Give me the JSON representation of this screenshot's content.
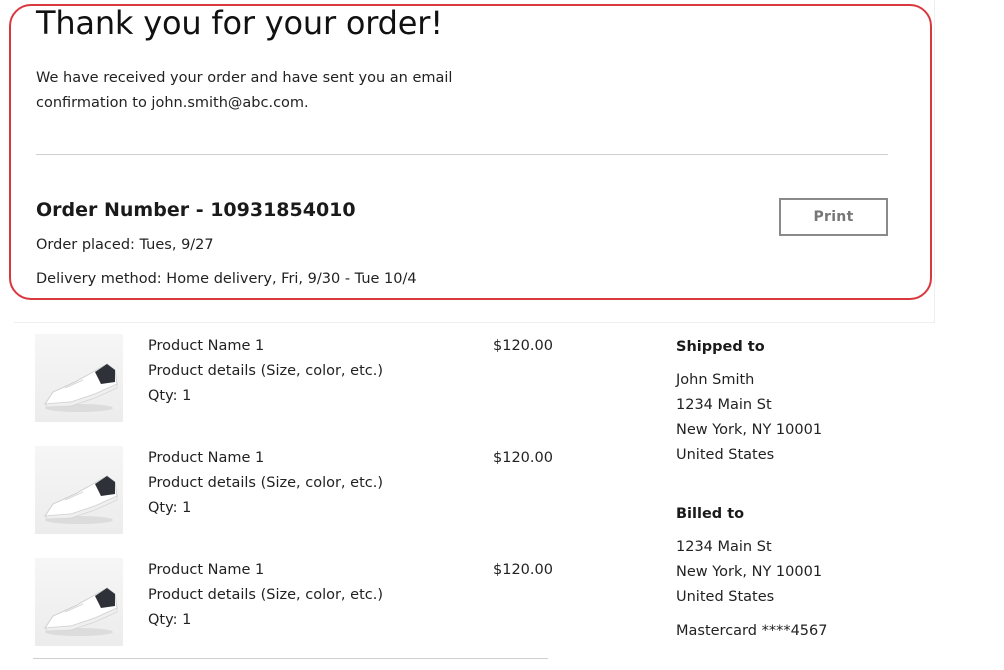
{
  "confirmation": {
    "title": "Thank you for your order!",
    "message": "We have received your order and have sent you an email confirmation to john.smith@abc.com."
  },
  "order": {
    "number_label": "Order Number - 10931854010",
    "placed": "Order placed: Tues, 9/27",
    "delivery": "Delivery method: Home delivery, Fri, 9/30 - Tue 10/4",
    "print_label": "Print"
  },
  "products": [
    {
      "name": "Product Name 1",
      "details": "Product details (Size, color, etc.)",
      "qty": "Qty: 1",
      "price": "$120.00",
      "image_icon": "white-sneaker-image"
    },
    {
      "name": "Product Name 1",
      "details": "Product details (Size, color, etc.)",
      "qty": "Qty: 1",
      "price": "$120.00",
      "image_icon": "white-sneaker-image"
    },
    {
      "name": "Product Name 1",
      "details": "Product details (Size, color, etc.)",
      "qty": "Qty: 1",
      "price": "$120.00",
      "image_icon": "white-sneaker-image"
    }
  ],
  "shipping": {
    "heading": "Shipped to",
    "lines": [
      "John Smith",
      "1234 Main St",
      "New York, NY 10001",
      "United States"
    ]
  },
  "billing": {
    "heading": "Billed to",
    "lines": [
      "1234 Main St",
      "New York, NY 10001",
      "United States"
    ],
    "payment": "Mastercard ****4567"
  },
  "colors": {
    "highlight": "#d9383e",
    "button_border": "#8a8a8a",
    "button_text": "#777777"
  }
}
